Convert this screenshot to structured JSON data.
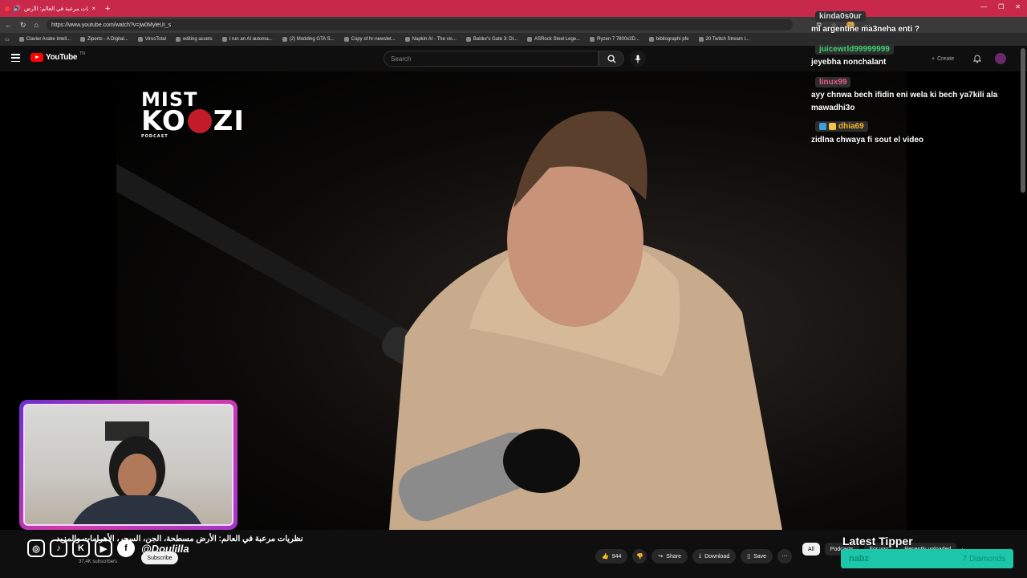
{
  "browser": {
    "tab_title": "نظريات مرعبة في العالم: الأرض",
    "tab_close": "×",
    "new_tab": "+",
    "url": "https://www.youtube.com/watch?v=jw0MyleUI_s",
    "bookmarks": [
      "Clavier Arabe Intell...",
      "Ziperto - A Digital...",
      "VirusTotal",
      "editing assets",
      "I run an AI automa...",
      "(2) Modding GTA S...",
      "Copy of hr-newslet...",
      "Napkin AI - The vis...",
      "Baldur's Gate 3: Di...",
      "ASRock Steel Lege...",
      "Ryzen 7 7800x3D...",
      "bibliographi pfe",
      "20 Twitch Stream I..."
    ]
  },
  "youtube": {
    "logo_text": "YouTube",
    "region": "TN",
    "search_placeholder": "Search",
    "create_label": "Create"
  },
  "video": {
    "brand_line1": "MIST",
    "brand_line2a": "KO",
    "brand_line2b": "ZI",
    "brand_line3": "PODCAST",
    "title": "نظريات مرعبة في العالم: الأرض مسطحة، الجن، السحر، الأهرامات والمزيد",
    "subscribers": "37.4K subscribers",
    "subscribe_label": "Subscribe",
    "likes": "944",
    "share_label": "Share",
    "download_label": "Download",
    "save_label": "Save"
  },
  "overlay": {
    "handle": "@Doulilla",
    "chat": [
      {
        "user": "kinda0s0ur",
        "text": "ml argentine ma3neha enti ?",
        "user_color": "#d9d9d9",
        "badges": 0
      },
      {
        "user": "juicewrld99999999",
        "text": "jeyebha nonchalant",
        "user_color": "#3bd16f",
        "badges": 0
      },
      {
        "user": "linux99",
        "text": "ayy chnwa bech ifidin eni wela ki bech ya7kili ala mawadhi3o",
        "user_color": "#e75a8a",
        "badges": 0
      },
      {
        "user": "dhia69",
        "text": "zidlna chwaya fi sout el video",
        "user_color": "#f0b429",
        "badges": 2
      }
    ],
    "latest_tipper_label": "Latest Tipper",
    "tipper_name": "nabz",
    "tipper_amount": "7 Diamonds"
  },
  "chips": [
    "All",
    "Podcasts",
    "For you",
    "Recently uploaded"
  ],
  "colors": {
    "tabbar": "#c8284a",
    "yt_red": "#ff0000",
    "cam_border": "#d43aa8",
    "tipper_bg": "#1cc6a8"
  }
}
